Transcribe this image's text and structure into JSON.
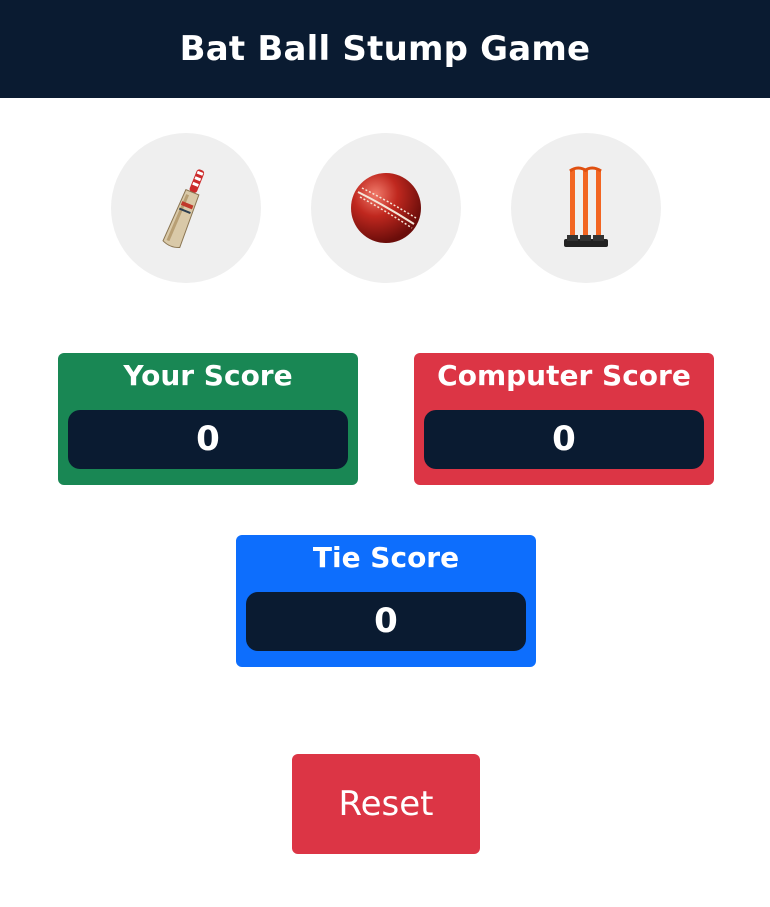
{
  "header": {
    "title": "Bat Ball Stump Game"
  },
  "choices": [
    {
      "name": "bat",
      "icon": "cricket-bat-icon"
    },
    {
      "name": "ball",
      "icon": "cricket-ball-icon"
    },
    {
      "name": "stump",
      "icon": "cricket-stumps-icon"
    }
  ],
  "scores": {
    "user": {
      "label": "Your Score",
      "value": "0",
      "color": "#198754"
    },
    "computer": {
      "label": "Computer Score",
      "value": "0",
      "color": "#dc3545"
    },
    "tie": {
      "label": "Tie Score",
      "value": "0",
      "color": "#0d6efd"
    }
  },
  "reset": {
    "label": "Reset",
    "color": "#dc3545"
  },
  "colors": {
    "header_bg": "#0a1b31",
    "score_value_bg": "#0a1b31",
    "choice_bg": "#efefef"
  }
}
